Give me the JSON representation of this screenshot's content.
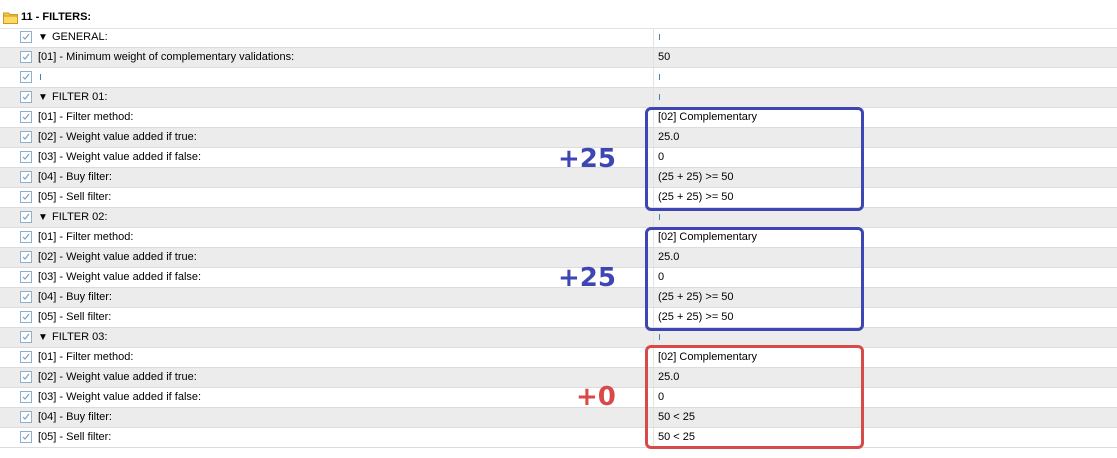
{
  "header": {
    "title": "11 - FILTERS:"
  },
  "sections": [
    {
      "label": "GENERAL:",
      "items": [
        {
          "label": "[01] - Minimum weight of complementary validations:",
          "value": "50"
        }
      ]
    },
    {
      "label": "FILTER 01:",
      "items": [
        {
          "label": "[01] - Filter method:",
          "value": "[02] Complementary"
        },
        {
          "label": "[02] - Weight value added if true:",
          "value": "25.0"
        },
        {
          "label": "[03] - Weight value added if false:",
          "value": "0"
        },
        {
          "label": "[04] - Buy filter:",
          "value": "(25 + 25) >= 50"
        },
        {
          "label": "[05] - Sell filter:",
          "value": "(25 + 25) >= 50"
        }
      ]
    },
    {
      "label": "FILTER 02:",
      "items": [
        {
          "label": "[01] - Filter method:",
          "value": "[02] Complementary"
        },
        {
          "label": "[02] - Weight value added if true:",
          "value": "25.0"
        },
        {
          "label": "[03] - Weight value added if false:",
          "value": "0"
        },
        {
          "label": "[04] - Buy filter:",
          "value": "(25 + 25) >= 50"
        },
        {
          "label": "[05] - Sell filter:",
          "value": "(25 + 25) >= 50"
        }
      ]
    },
    {
      "label": "FILTER 03:",
      "items": [
        {
          "label": "[01] - Filter method:",
          "value": "[02] Complementary"
        },
        {
          "label": "[02] - Weight value added if true:",
          "value": "25.0"
        },
        {
          "label": "[03] - Weight value added if false:",
          "value": "0"
        },
        {
          "label": "[04] - Buy filter:",
          "value": "50 < 25"
        },
        {
          "label": "[05] - Sell filter:",
          "value": "50 < 25"
        }
      ]
    }
  ],
  "annotations": {
    "filter01": "+25",
    "filter02": "+25",
    "filter03": "+0"
  },
  "colors": {
    "blue_annotation": "#3d46b2",
    "red_annotation": "#d84a4a",
    "checkbox_border": "#8fb0cc",
    "alt_row_bg": "#ececec"
  }
}
